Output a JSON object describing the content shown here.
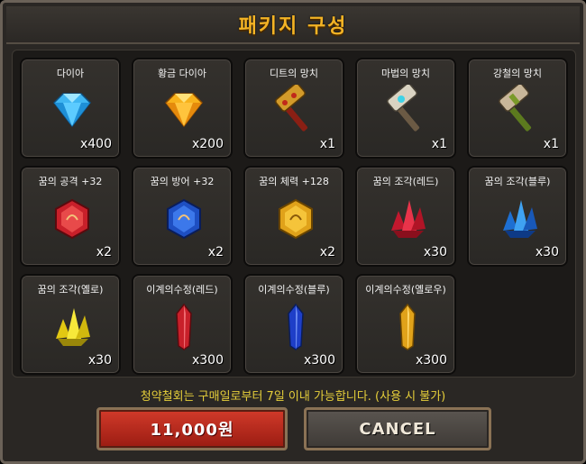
{
  "dialog": {
    "title": "패키지 구성",
    "notice": "청약철회는 구매일로부터 7일 이내 가능합니다. (사용 시 불가)",
    "buy_label": "11,000원",
    "cancel_label": "CANCEL"
  },
  "items": [
    {
      "name": "다이아",
      "qty": "x400",
      "icon": "blue-diamond-icon"
    },
    {
      "name": "황금 다이아",
      "qty": "x200",
      "icon": "gold-diamond-icon"
    },
    {
      "name": "디트의 망치",
      "qty": "x1",
      "icon": "red-hammer-icon"
    },
    {
      "name": "마법의 망치",
      "qty": "x1",
      "icon": "magic-hammer-icon"
    },
    {
      "name": "강철의 망치",
      "qty": "x1",
      "icon": "steel-hammer-icon"
    },
    {
      "name": "꿈의 공격 +32",
      "qty": "x2",
      "icon": "red-dream-stone-icon"
    },
    {
      "name": "꿈의 방어 +32",
      "qty": "x2",
      "icon": "blue-dream-stone-icon"
    },
    {
      "name": "꿈의 체력 +128",
      "qty": "x2",
      "icon": "gold-dream-stone-icon"
    },
    {
      "name": "꿈의 조각(레드)",
      "qty": "x30",
      "icon": "red-crystal-cluster-icon"
    },
    {
      "name": "꿈의 조각(블루)",
      "qty": "x30",
      "icon": "blue-crystal-cluster-icon"
    },
    {
      "name": "꿈의 조각(옐로)",
      "qty": "x30",
      "icon": "yellow-crystal-cluster-icon"
    },
    {
      "name": "이계의수정(레드)",
      "qty": "x300",
      "icon": "red-shard-icon"
    },
    {
      "name": "이계의수정(블루)",
      "qty": "x300",
      "icon": "blue-shard-icon"
    },
    {
      "name": "이계의수정(옐로우)",
      "qty": "x300",
      "icon": "yellow-shard-icon"
    }
  ]
}
